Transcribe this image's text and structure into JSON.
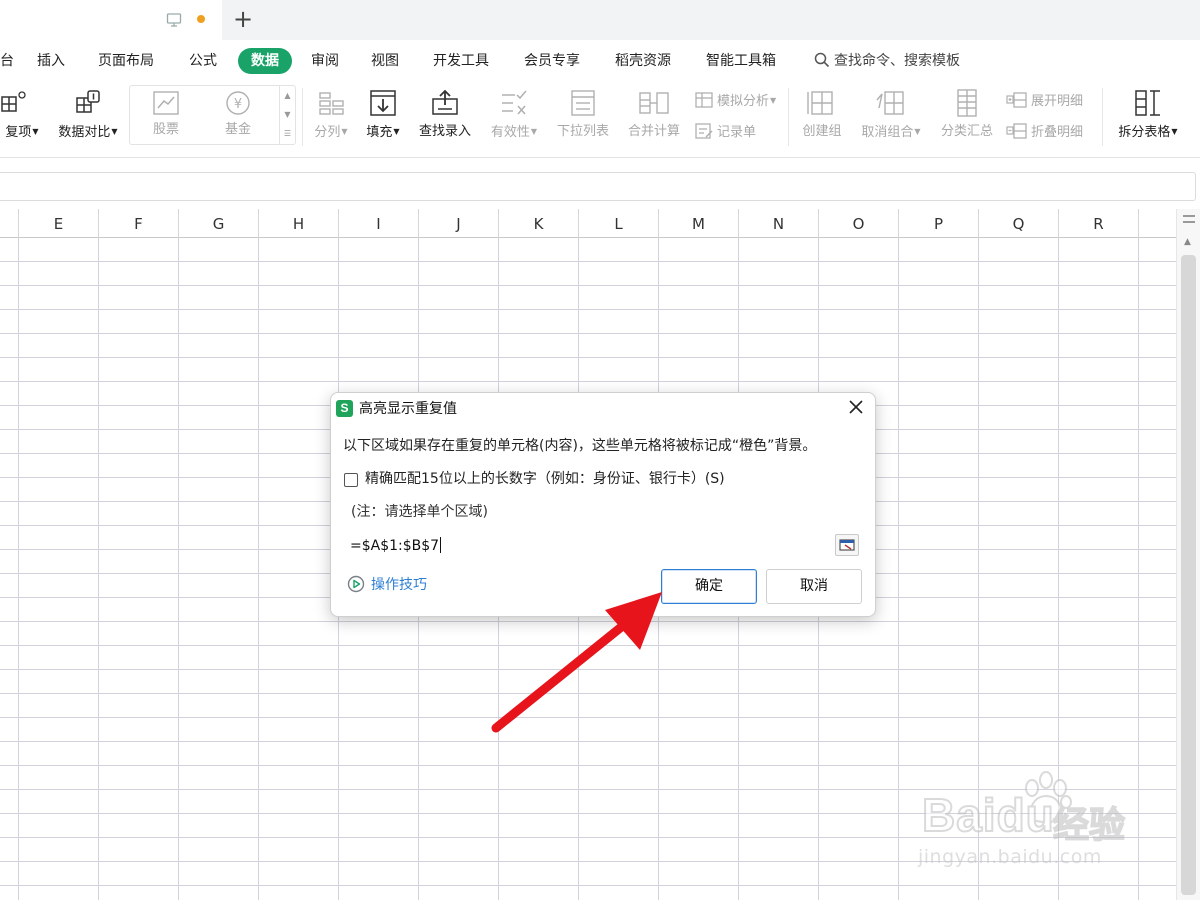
{
  "tabs": {
    "plus": "+",
    "dot_color": "#f0a020"
  },
  "menu": {
    "items": [
      "台",
      "插入",
      "页面布局",
      "公式",
      "数据",
      "审阅",
      "视图",
      "开发工具",
      "会员专享",
      "稻壳资源",
      "智能工具箱"
    ],
    "active": "数据",
    "search": "查找命令、搜索模板"
  },
  "ribbon": {
    "duplicates": "复项",
    "compare": "数据对比",
    "stock": "股票",
    "fund": "基金",
    "split": "分列",
    "fill": "填充",
    "lookup": "查找录入",
    "validity": "有效性",
    "dropdown": "下拉列表",
    "consolidate": "合并计算",
    "whatif": "模拟分析",
    "record": "记录单",
    "group": "创建组",
    "ungroup": "取消组合",
    "subtotal": "分类汇总",
    "expand": "展开明细",
    "collapse": "折叠明细",
    "split_table": "拆分表格"
  },
  "sheet": {
    "columns": [
      "E",
      "F",
      "G",
      "H",
      "I",
      "J",
      "K",
      "L",
      "M",
      "N",
      "O",
      "P",
      "Q",
      "R"
    ]
  },
  "dialog": {
    "title": "高亮显示重复值",
    "description": "以下区域如果存在重复的单元格(内容)，这些单元格将被标记成“橙色”背景。",
    "checkbox_label": "精确匹配15位以上的长数字（例如：身份证、银行卡）(S)",
    "checkbox_checked": false,
    "note": "(注：请选择单个区域)",
    "range_value": "=$A$1:$B$7",
    "tips": "操作技巧",
    "ok": "确定",
    "cancel": "取消"
  },
  "watermark": {
    "brand": "Baidu",
    "cn": "经验",
    "url": "jingyan.baidu.com"
  },
  "colors": {
    "accent_green": "#1aa368",
    "link_blue": "#2e7fd3",
    "arrow_red": "#e8141b"
  }
}
